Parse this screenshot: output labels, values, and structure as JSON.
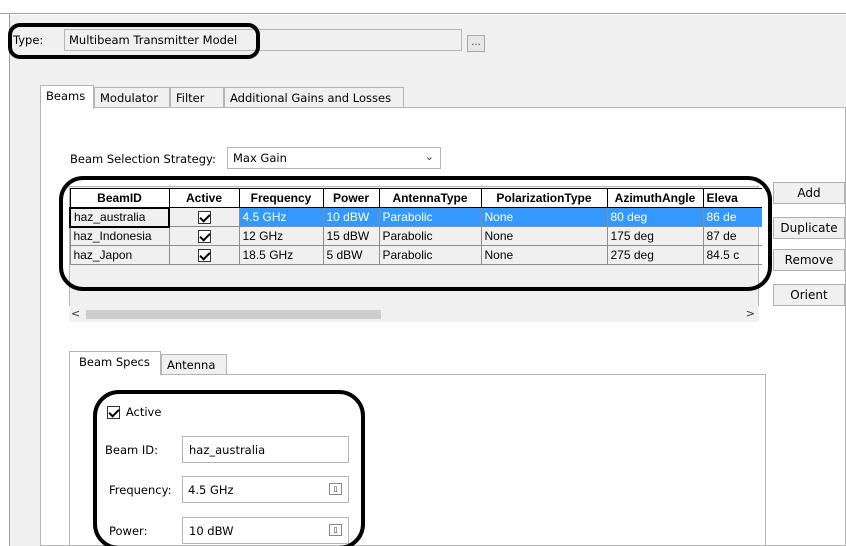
{
  "type_row": {
    "label": "Type:",
    "value": "Multibeam Transmitter Model",
    "browse_label": "..."
  },
  "main_tabs": [
    "Beams",
    "Modulator",
    "Filter",
    "Additional Gains and Losses"
  ],
  "beam_selection": {
    "label": "Beam Selection Strategy:",
    "value": "Max Gain"
  },
  "grid": {
    "columns": [
      "BeamID",
      "Active",
      "Frequency",
      "Power",
      "AntennaType",
      "PolarizationType",
      "AzimuthAngle",
      "Eleva"
    ],
    "rows": [
      {
        "beam_id": "haz_australia",
        "active": true,
        "frequency": "4.5 GHz",
        "power": "10 dBW",
        "antenna_type": "Parabolic",
        "polarization": "None",
        "azimuth": "80 deg",
        "elevation": "86 de"
      },
      {
        "beam_id": "haz_Indonesia",
        "active": true,
        "frequency": "12 GHz",
        "power": "15 dBW",
        "antenna_type": "Parabolic",
        "polarization": "None",
        "azimuth": "175 deg",
        "elevation": "87 de"
      },
      {
        "beam_id": "haz_Japon",
        "active": true,
        "frequency": "18.5 GHz",
        "power": "5 dBW",
        "antenna_type": "Parabolic",
        "polarization": "None",
        "azimuth": "275 deg",
        "elevation": "84.5 c"
      }
    ],
    "scroll_left": "<",
    "scroll_right": ">"
  },
  "side_buttons": {
    "add": "Add",
    "duplicate": "Duplicate",
    "remove": "Remove",
    "orient": "Orient"
  },
  "sub_tabs": [
    "Beam Specs",
    "Antenna"
  ],
  "beam_specs": {
    "active_label": "Active",
    "active_checked": true,
    "beam_id_label": "Beam ID:",
    "beam_id_value": "haz_australia",
    "frequency_label": "Frequency:",
    "frequency_value": "4.5 GHz",
    "power_label": "Power:",
    "power_value": "10 dBW"
  },
  "colors": {
    "selection": "#3399ff",
    "panel": "#f0f0f0",
    "callout": "#000000"
  }
}
